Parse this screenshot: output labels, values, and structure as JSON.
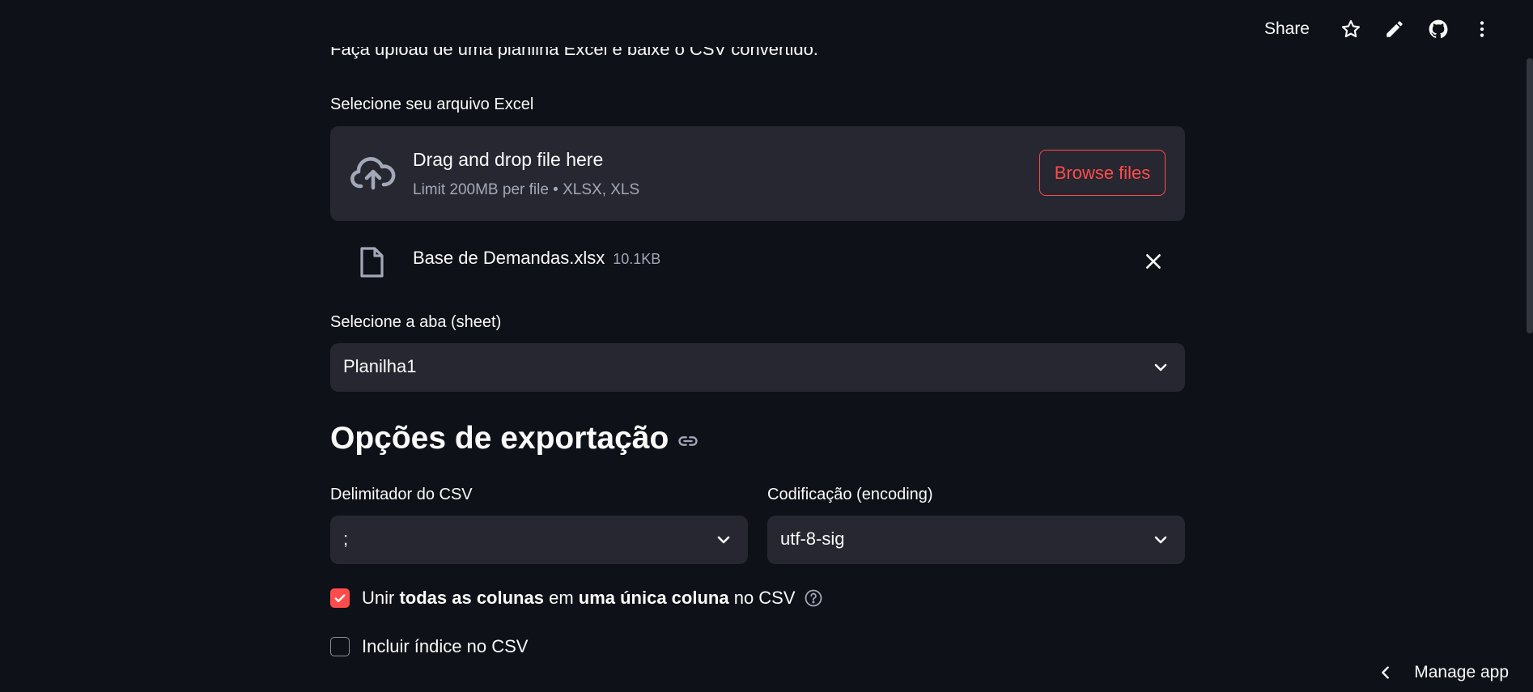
{
  "toolbar": {
    "share_label": "Share"
  },
  "intro": {
    "text": "Faça upload de uma planilha Excel e baixe o CSV convertido."
  },
  "uploader": {
    "label": "Selecione seu arquivo Excel",
    "dz_title": "Drag and drop file here",
    "dz_subtitle": "Limit 200MB per file • XLSX, XLS",
    "browse_label": "Browse files",
    "file_name": "Base de Demandas.xlsx",
    "file_size": "10.1KB"
  },
  "sheet": {
    "label": "Selecione a aba (sheet)",
    "value": "Planilha1"
  },
  "export": {
    "heading": "Opções de exportação",
    "delimiter_label": "Delimitador do CSV",
    "delimiter_value": ";",
    "encoding_label": "Codificação (encoding)",
    "encoding_value": "utf-8-sig"
  },
  "options": {
    "merge": {
      "p1": "Unir ",
      "b1": "todas as colunas",
      "p2": " em ",
      "b2": "uma única coluna",
      "p3": " no CSV",
      "checked": true
    },
    "index": {
      "label": "Incluir índice no CSV",
      "checked": false
    }
  },
  "footer": {
    "manage_label": "Manage app"
  },
  "colors": {
    "accent": "#ff4b4b",
    "background": "#0e1117",
    "surface": "#262730"
  }
}
